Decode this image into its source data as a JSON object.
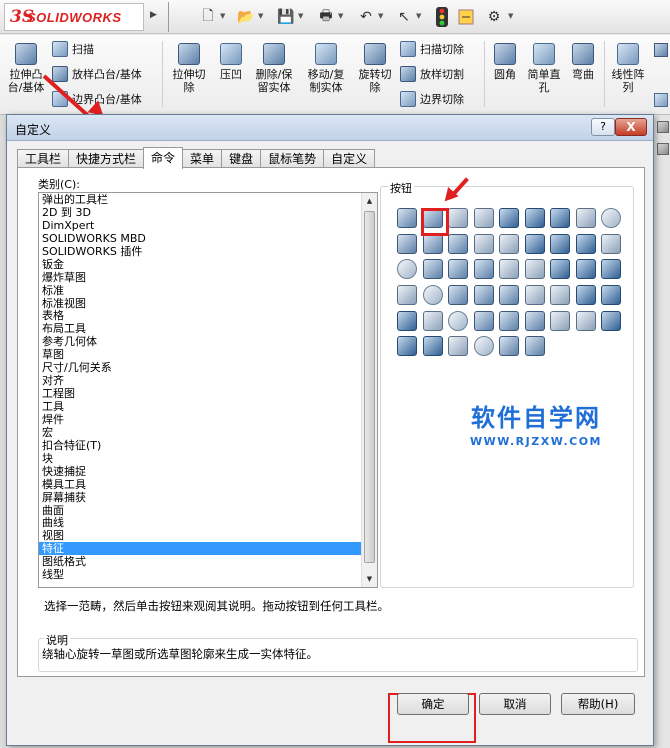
{
  "app": {
    "logo_text": "SOLIDWORKS",
    "logo_mark": "3S"
  },
  "ribbon": {
    "extrude_boss": "拉伸凸\n台/基体",
    "sweep": "扫描",
    "loft": "放样凸台/基体",
    "boundary_boss": "边界凸台/基体",
    "extrude_cut": "拉伸切\n除",
    "indent": "压凹",
    "delete_keep": "删除/保\n留实体",
    "move_copy": "移动/复\n制实体",
    "revolve_cut": "旋转切\n除",
    "sweep_cut": "扫描切除",
    "loft_cut": "放样切割",
    "boundary_cut": "边界切除",
    "fillet": "圆角",
    "simple_hole": "简单直\n孔",
    "flex": "弯曲",
    "linear_pattern": "线性阵\n列"
  },
  "dialog": {
    "title": "自定义",
    "help": "?",
    "close": "X",
    "tabs": [
      "工具栏",
      "快捷方式栏",
      "命令",
      "菜单",
      "键盘",
      "鼠标笔势",
      "自定义"
    ],
    "category_label": "类别(C):",
    "categories": [
      "弹出的工具栏",
      "2D 到 3D",
      "DimXpert",
      "SOLIDWORKS MBD",
      "SOLIDWORKS 插件",
      "钣金",
      "爆炸草图",
      "标准",
      "标准视图",
      "表格",
      "布局工具",
      "参考几何体",
      "草图",
      "尺寸/几何关系",
      "对齐",
      "工程图",
      "工具",
      "焊件",
      "宏",
      "扣合特征(T)",
      "块",
      "快速捕捉",
      "模具工具",
      "屏幕捕获",
      "曲面",
      "曲线",
      "视图",
      "特征",
      "图纸格式",
      "线型"
    ],
    "selected_category": "特征",
    "buttons_label": "按钮",
    "hint": "选择一范畴，然后单击按钮来观阅其说明。拖动按钮到任何工具栏。",
    "description_label": "说明",
    "description": "绕轴心旋转一草图或所选草图轮廓来生成一实体特征。",
    "ok": "确定",
    "cancel": "取消",
    "help_button": "帮助(H)"
  },
  "watermark": {
    "line1": "软件自学网",
    "line2": "WWW.RJZXW.COM"
  },
  "colors": {
    "selection": "#3399ff",
    "highlight": "#e02020",
    "watermark": "#1f6fd6"
  }
}
